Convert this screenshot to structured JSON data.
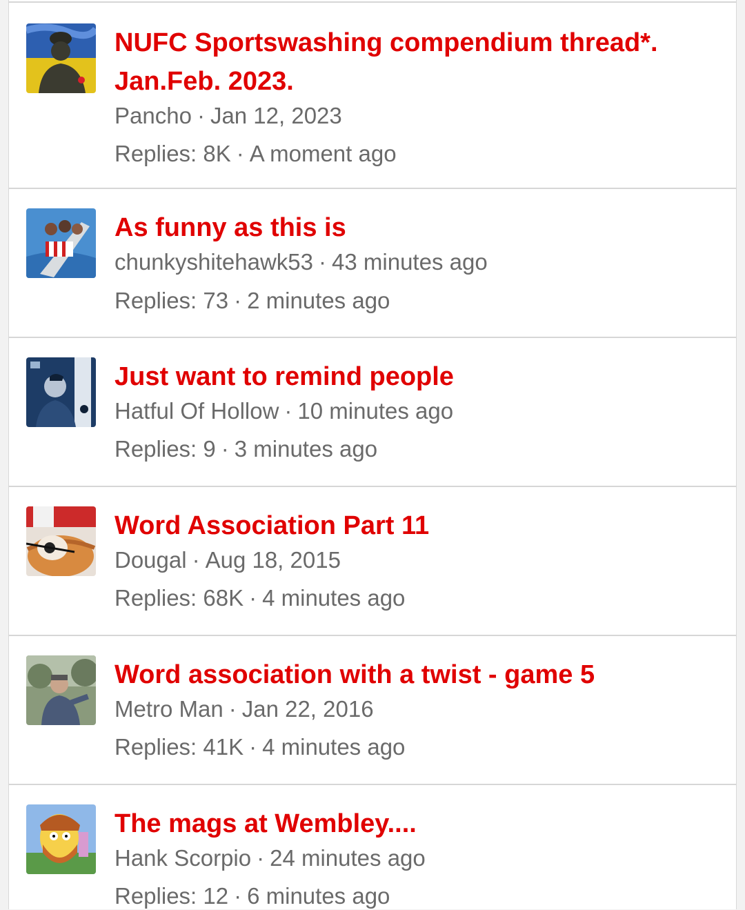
{
  "threads": [
    {
      "title": "NUFC Sportswashing compendium thread*. Jan.Feb. 2023.",
      "author": "Pancho",
      "started": "Jan 12, 2023",
      "replies": "Replies: 8K",
      "last_post": "A moment ago"
    },
    {
      "title": "As funny as this is",
      "author": "chunkyshitehawk53",
      "started": "43 minutes ago",
      "replies": "Replies: 73",
      "last_post": "2 minutes ago"
    },
    {
      "title": "Just want to remind people",
      "author": "Hatful Of Hollow",
      "started": "10 minutes ago",
      "replies": "Replies: 9",
      "last_post": "3 minutes ago"
    },
    {
      "title": "Word Association Part 11",
      "author": "Dougal",
      "started": "Aug 18, 2015",
      "replies": "Replies: 68K",
      "last_post": "4 minutes ago"
    },
    {
      "title": "Word association with a twist - game 5",
      "author": "Metro Man",
      "started": "Jan 22, 2016",
      "replies": "Replies: 41K",
      "last_post": "4 minutes ago"
    },
    {
      "title": "The mags at Wembley....",
      "author": "Hank Scorpio",
      "started": "24 minutes ago",
      "replies": "Replies: 12",
      "last_post": "6 minutes ago"
    }
  ],
  "separator": "·",
  "colors": {
    "title": "#e00000",
    "meta": "#6a6a6a",
    "divider": "#d6d6d6"
  }
}
